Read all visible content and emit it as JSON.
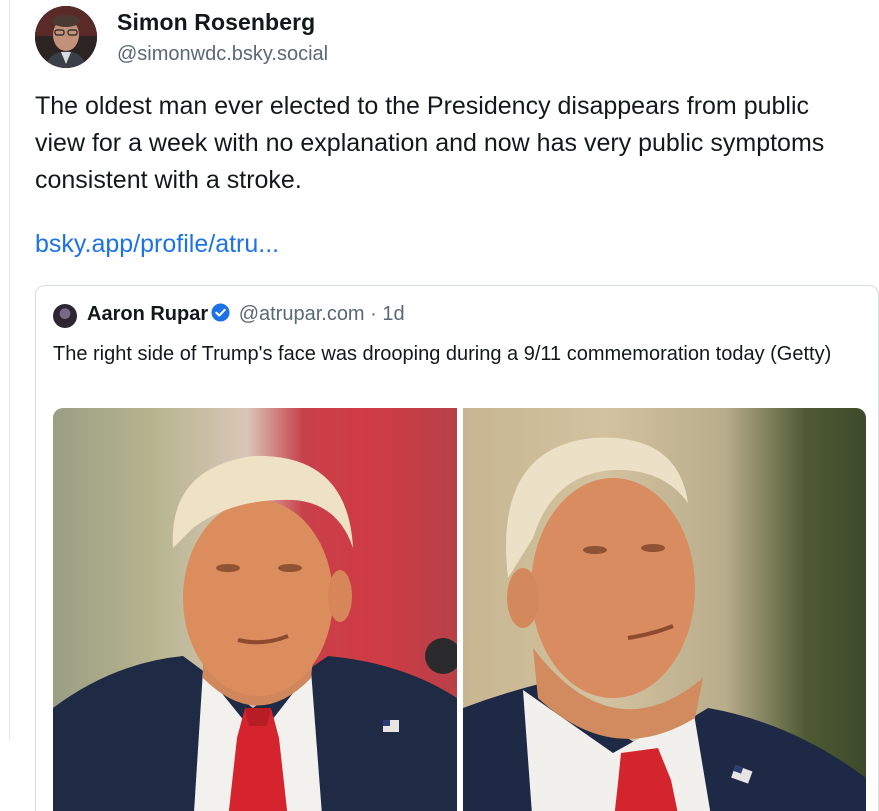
{
  "post": {
    "author_name": "Simon Rosenberg",
    "author_handle": "@simonwdc.bsky.social",
    "text": "The oldest man ever elected to the Presidency disappears from public view for a week with no explanation and now has very public symptoms consistent with a stroke.",
    "link_text": "bsky.app/profile/atru..."
  },
  "quote": {
    "author_name": "Aaron Rupar",
    "author_handle": "@atrupar.com",
    "separator": " · ",
    "time": "1d",
    "text": "The right side of Trump's face was drooping during a 9/11 commemoration today (Getty)",
    "verified_icon": "verified-check-icon"
  },
  "colors": {
    "link": "#1d72e8",
    "verified": "#1d72e8",
    "muted_text": "#5b6875"
  }
}
